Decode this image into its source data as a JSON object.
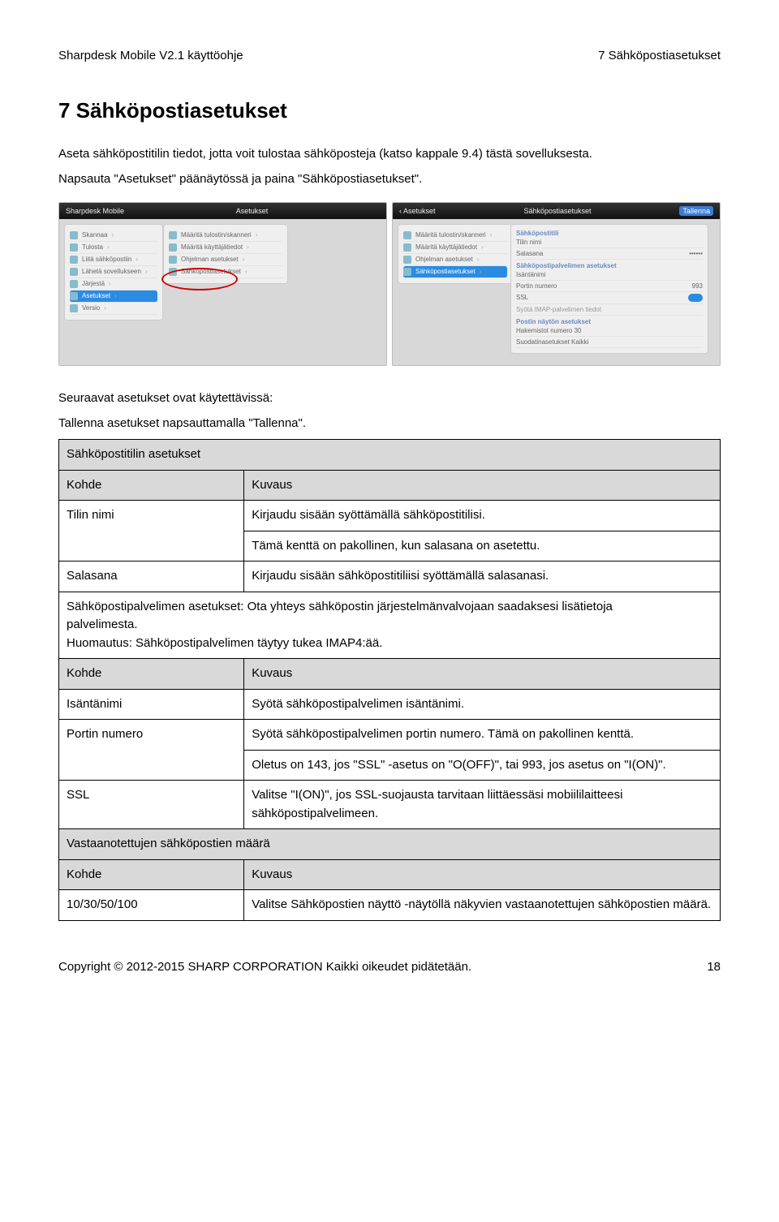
{
  "header": {
    "left": "Sharpdesk Mobile V2.1 käyttöohje",
    "right": "7 Sähköpostiasetukset"
  },
  "title": "7   Sähköpostiasetukset",
  "intro1": "Aseta sähköpostitilin tiedot, jotta voit tulostaa sähköposteja (katso kappale 9.4) tästä sovelluksesta.",
  "intro2": "Napsauta \"Asetukset\" päänäytössä ja paina \"Sähköpostiasetukset\".",
  "after_shots_p1": "Seuraavat asetukset ovat käytettävissä:",
  "after_shots_p2": "Tallenna asetukset napsauttamalla \"Tallenna\".",
  "table": {
    "section1_title": "Sähköpostitilin asetukset",
    "hdr_kohde": "Kohde",
    "hdr_kuvaus": "Kuvaus",
    "tilin_nimi": "Tilin nimi",
    "tilin_nimi_v1": "Kirjaudu sisään syöttämällä sähköpostitilisi.",
    "tilin_nimi_v2": "Tämä kenttä on pakollinen, kun salasana on asetettu.",
    "salasana": "Salasana",
    "salasana_v": "Kirjaudu sisään sähköpostitiliisi syöttämällä salasanasi.",
    "server_note_a": "Sähköpostipalvelimen asetukset: Ota yhteys sähköpostin järjestelmänvalvojaan saadaksesi lisätietoja",
    "server_note_b": "palvelimesta.",
    "server_note_c": "Huomautus: Sähköpostipalvelimen täytyy tukea IMAP4:ää.",
    "isanta": "Isäntänimi",
    "isanta_v": "Syötä sähköpostipalvelimen isäntänimi.",
    "portin": "Portin numero",
    "portin_v1": "Syötä sähköpostipalvelimen portin numero. Tämä on pakollinen kenttä.",
    "portin_v2": "Oletus on 143, jos \"SSL\" -asetus on \"O(OFF)\", tai 993, jos asetus on \"I(ON)\".",
    "ssl": "SSL",
    "ssl_v": "Valitse \"I(ON)\", jos SSL-suojausta tarvitaan liittäessäsi mobiililaitteesi sähköpostipalvelimeen.",
    "vastaan_title": "Vastaanotettujen sähköpostien määrä",
    "count_k": "10/30/50/100",
    "count_v": "Valitse Sähköpostien näyttö -näytöllä näkyvien vastaanotettujen sähköpostien määrä."
  },
  "shots": {
    "s1_top": "Sharpdesk Mobile",
    "s1_top_center": "Asetukset",
    "s1_left": [
      "Skannaa",
      "Tulosta",
      "Liitä sähköpostiin",
      "Lähetä sovellukseen",
      "Järjestä",
      "Asetukset",
      "Versio"
    ],
    "s1_right": [
      "Määritä tulostin/skanneri",
      "Määritä käyttäjätiedot",
      "Ohjelman asetukset",
      "Sähköpostiasetukset"
    ],
    "s2_col_a": [
      "Määritä tulostin/skanneri",
      "Määritä käyttäjätiedot",
      "Ohjelman asetukset",
      "Sähköpostiasetukset"
    ],
    "s2_col_b_hdr1": "Sähköpostitili",
    "s2_col_b_rows1": [
      "Tilin nimi",
      "Salasana"
    ],
    "s2_col_b_hdr2": "Sähköpostipalvelimen asetukset",
    "s2_col_b_rows2": [
      "Isäntänimi",
      "Portin numero",
      "SSL",
      "Syötä IMAP-palvelimen tiedot"
    ],
    "s2_col_b_hdr3": "Postin näytön asetukset",
    "s2_col_b_rows3": [
      "Hakemistot numero   30",
      "Suodatinasetukset   Kaikki"
    ]
  },
  "footer": {
    "left": "Copyright © 2012-2015 SHARP CORPORATION Kaikki oikeudet pidätetään.",
    "right": "18"
  }
}
